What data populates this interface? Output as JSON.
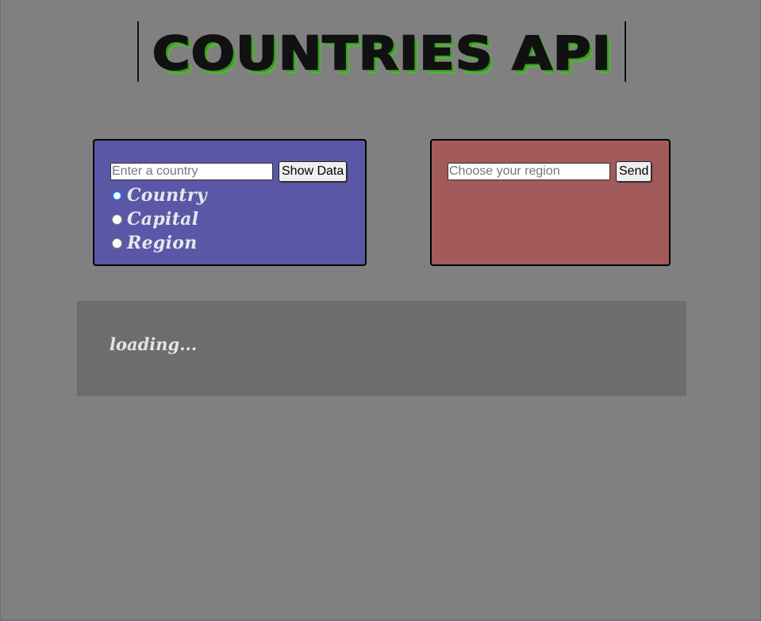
{
  "header": {
    "title": "COUNTRIES API"
  },
  "country_card": {
    "search": {
      "placeholder": "Enter a country",
      "value": ""
    },
    "show_button_label": "Show Data",
    "options": [
      {
        "label": "Country",
        "checked": true
      },
      {
        "label": "Capital",
        "checked": false
      },
      {
        "label": "Region",
        "checked": false
      }
    ],
    "background": "#5a58a6"
  },
  "region_card": {
    "search": {
      "placeholder": "Choose your region",
      "value": ""
    },
    "send_button_label": "Send",
    "background": "#a25a5a"
  },
  "results": {
    "status_text": "loading..."
  },
  "colors": {
    "page_background": "#808080",
    "title_shadow": "#4cbf2c",
    "results_background": "#6e6c6c"
  }
}
